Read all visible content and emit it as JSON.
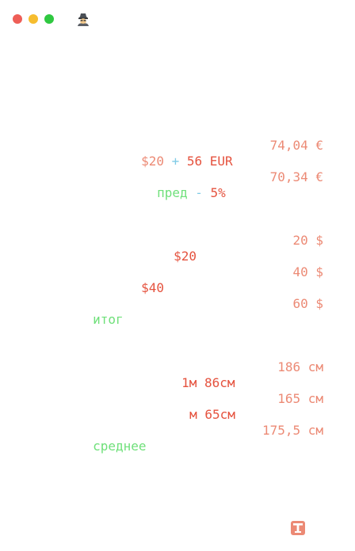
{
  "window": {
    "icons": {
      "close": "close-button",
      "minimize": "minimize-button",
      "maximize": "maximize-button",
      "app": "detective-icon",
      "footer": "text-format-icon"
    },
    "colors": {
      "close": "#ee5e57",
      "minimize": "#f6bd2f",
      "maximize": "#2fc840",
      "number": "#e5533f",
      "result": "#ec8a75",
      "operator": "#80cbe6",
      "variable": "#6fe07a"
    }
  },
  "lines": [
    {
      "tokens": [
        {
          "text": "$20",
          "kind": "soft"
        },
        {
          "text": " + ",
          "kind": "op"
        },
        {
          "text": "56 EUR",
          "kind": "num"
        }
      ],
      "result": "74,04 €"
    },
    {
      "tokens": [
        {
          "text": "пред",
          "kind": "var"
        },
        {
          "text": " - ",
          "kind": "op"
        },
        {
          "text": "5%",
          "kind": "num"
        }
      ],
      "result": "70,34 €"
    },
    {
      "tokens": [
        {
          "text": "$20",
          "kind": "num"
        }
      ],
      "result": "20 $"
    },
    {
      "tokens": [
        {
          "text": "$40",
          "kind": "num"
        }
      ],
      "result": "40 $"
    },
    {
      "tokens": [
        {
          "text": "итог",
          "kind": "var"
        }
      ],
      "result": "60 $"
    },
    {
      "tokens": [
        {
          "text": "1м 86см",
          "kind": "num"
        }
      ],
      "result": "186 см"
    },
    {
      "tokens": [
        {
          "text": "м 65см",
          "kind": "num"
        }
      ],
      "result": "165 см"
    },
    {
      "tokens": [
        {
          "text": "среднее",
          "kind": "var"
        }
      ],
      "result": "175,5 см"
    }
  ]
}
